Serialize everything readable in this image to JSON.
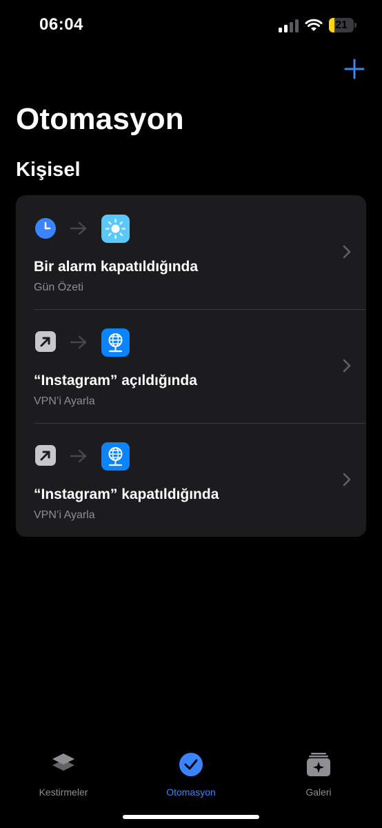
{
  "status_bar": {
    "time": "06:04",
    "battery_label": "21",
    "battery_percent": 21,
    "battery_color": "#ffd60a",
    "signal_icon": "cellular-signal-icon",
    "wifi_icon": "wifi-icon"
  },
  "header": {
    "add_icon": "plus-icon",
    "title": "Otomasyon"
  },
  "section": {
    "title": "Kişisel"
  },
  "automations": [
    {
      "trigger_icon": "clock-icon",
      "action_icon": "sun-icon",
      "title": "Bir alarm kapatıldığında",
      "subtitle": "Gün Özeti"
    },
    {
      "trigger_icon": "app-open-arrow-icon",
      "action_icon": "vpn-globe-icon",
      "title": "“Instagram” açıldığında",
      "subtitle": "VPN’i Ayarla"
    },
    {
      "trigger_icon": "app-open-arrow-icon",
      "action_icon": "vpn-globe-icon",
      "title": "“Instagram” kapatıldığında",
      "subtitle": "VPN’i Ayarla"
    }
  ],
  "tab_bar": {
    "tabs": [
      {
        "label": "Kestirmeler",
        "icon": "layers-icon",
        "active": false
      },
      {
        "label": "Otomasyon",
        "icon": "clock-check-icon",
        "active": true
      },
      {
        "label": "Galeri",
        "icon": "gallery-sparkle-icon",
        "active": false
      }
    ]
  },
  "colors": {
    "accent": "#3a84ff",
    "background": "#000000",
    "card": "#1c1c1e",
    "secondary_text": "#8e8e93"
  }
}
